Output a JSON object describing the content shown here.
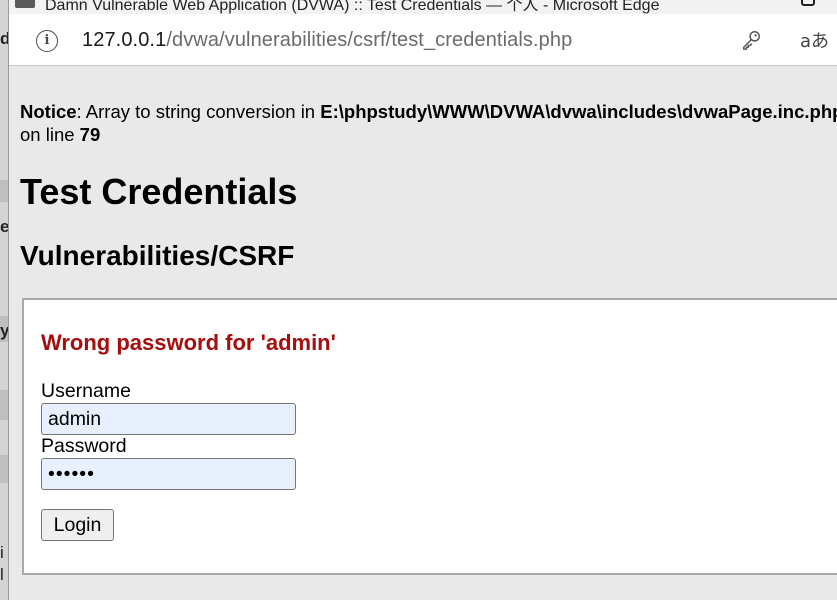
{
  "background_window": {
    "left_fragments": [
      "d",
      "e",
      "y",
      "i",
      "l"
    ]
  },
  "window": {
    "title": "Damn Vulnerable Web Application (DVWA) :: Test Credentials — 个人 - Microsoft Edge"
  },
  "address_bar": {
    "url_host": "127.0.0.1",
    "url_path": "/dvwa/vulnerabilities/csrf/test_credentials.php"
  },
  "notice": {
    "label": "Notice",
    "message": ": Array to string conversion in ",
    "file": "E:\\phpstudy\\WWW\\DVWA\\dvwa\\includes\\dvwaPage.inc.php",
    "line_prefix": "on line ",
    "line_number": "79"
  },
  "page": {
    "title": "Test Credentials",
    "subtitle": "Vulnerabilities/CSRF"
  },
  "form": {
    "error_message": "Wrong password for 'admin'",
    "username_label": "Username",
    "username_value": "admin",
    "password_label": "Password",
    "password_value": "••••••",
    "login_label": "Login"
  },
  "colors": {
    "error": "#a50e0e",
    "autofill": "#e8f0fe"
  },
  "icons": {
    "info": "info-icon",
    "key": "key-icon",
    "read_aloud": "read-aloud-icon"
  }
}
